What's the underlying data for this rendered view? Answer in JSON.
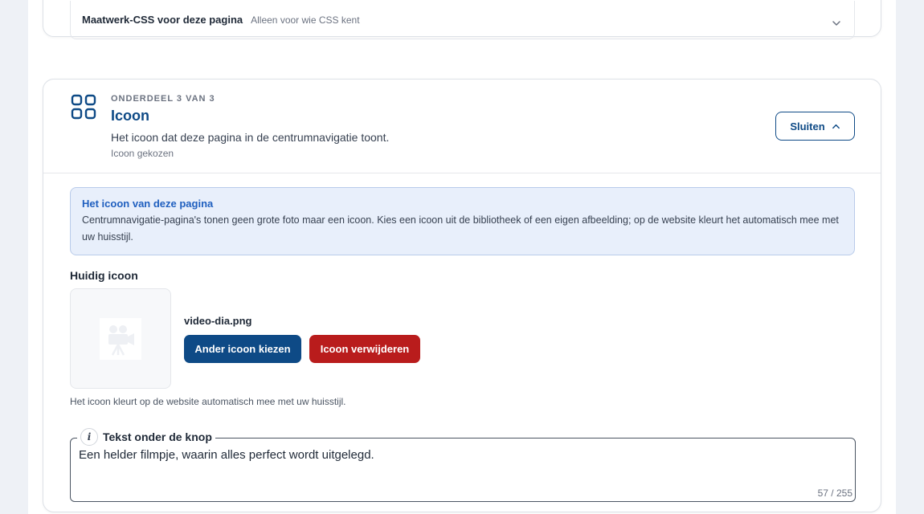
{
  "top_section": {
    "accordion_title": "Maatwerk-CSS voor deze pagina",
    "accordion_hint": "Alleen voor wie CSS kent"
  },
  "section": {
    "kicker": "ONDERDEEL 3 VAN 3",
    "title": "Icoon",
    "description": "Het icoon dat deze pagina in de centrumnavigatie toont.",
    "status": "Icoon gekozen",
    "close_label": "Sluiten",
    "icon": "grid-icon"
  },
  "info_box": {
    "title": "Het icoon van deze pagina",
    "text": "Centrumnavigatie-pagina's tonen geen grote foto maar een icoon. Kies een icoon uit de bibliotheek of een eigen afbeelding; op de website kleurt het automatisch mee met uw huisstijl."
  },
  "current_icon": {
    "label": "Huidig icoon",
    "filename": "video-dia.png",
    "thumbnail_icon": "video-camera-icon",
    "choose_label": "Ander icoon kiezen",
    "remove_label": "Icoon verwijderen",
    "hint": "Het icoon kleurt op de website automatisch mee met uw huisstijl."
  },
  "text_field": {
    "label": "Tekst onder de knop",
    "info_icon": "info-icon",
    "value": "Een helder filmpje, waarin alles perfect wordt uitgelegd.",
    "counter": "57 / 255"
  },
  "colors": {
    "brand": "#0e4a86",
    "danger": "#b91c1c",
    "info_bg": "#e8effb",
    "info_title": "#1f5fbf"
  }
}
